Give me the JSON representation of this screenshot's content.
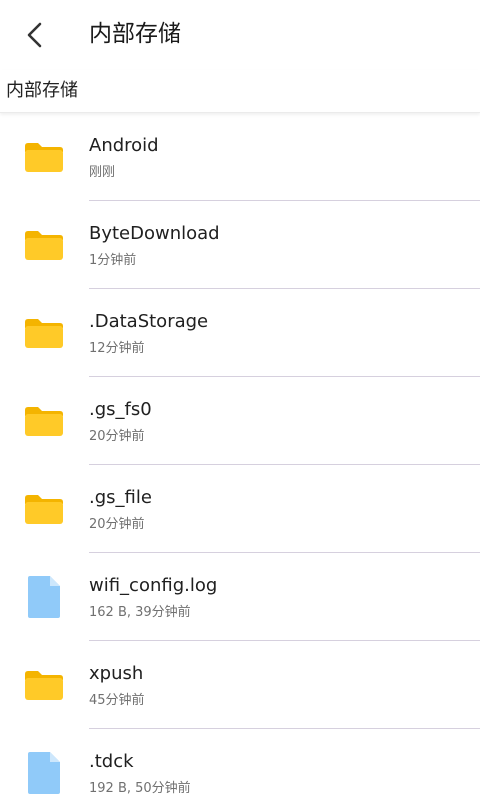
{
  "header": {
    "title": "内部存储"
  },
  "breadcrumb": {
    "path": "内部存储"
  },
  "colors": {
    "folder": "#FFCA28",
    "folder_tab": "#F4B400",
    "document": "#90CAF9",
    "divider": "#D6D0DE"
  },
  "files": [
    {
      "name": "Android",
      "meta": "刚刚",
      "icon": "folder-icon"
    },
    {
      "name": "ByteDownload",
      "meta": "1分钟前",
      "icon": "folder-icon"
    },
    {
      "name": ".DataStorage",
      "meta": "12分钟前",
      "icon": "folder-icon"
    },
    {
      "name": ".gs_fs0",
      "meta": "20分钟前",
      "icon": "folder-icon"
    },
    {
      "name": ".gs_file",
      "meta": "20分钟前",
      "icon": "folder-icon"
    },
    {
      "name": "wifi_config.log",
      "meta": "162 B, 39分钟前",
      "icon": "document-icon"
    },
    {
      "name": "xpush",
      "meta": "45分钟前",
      "icon": "folder-icon"
    },
    {
      "name": ".tdck",
      "meta": "192 B, 50分钟前",
      "icon": "document-icon"
    }
  ]
}
